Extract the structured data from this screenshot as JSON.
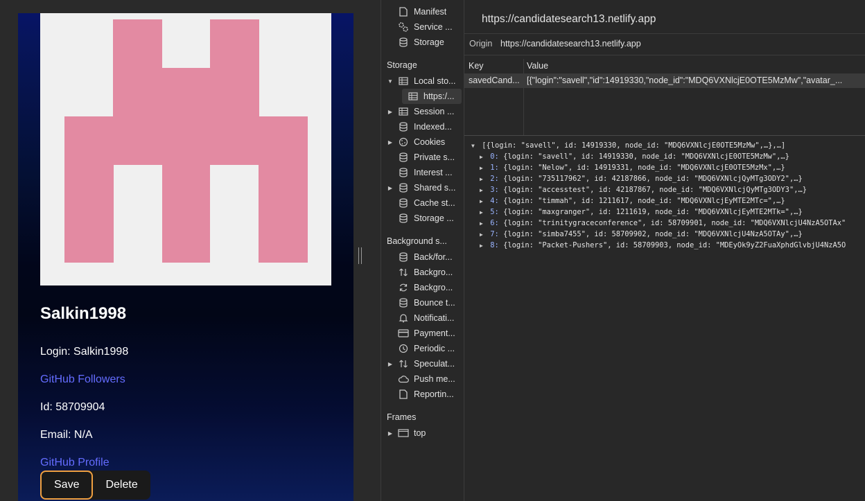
{
  "candidate": {
    "name": "Salkin1998",
    "login_line": "Login: Salkin1998",
    "followers_link": "GitHub Followers",
    "id_line": "Id: 58709904",
    "email_line": "Email: N/A",
    "profile_link": "GitHub Profile",
    "save_label": "Save",
    "delete_label": "Delete"
  },
  "devtools": {
    "sidebar": {
      "app_items": [
        {
          "label": "Manifest",
          "icon": "document-icon"
        },
        {
          "label": "Service ...",
          "icon": "gears-icon"
        },
        {
          "label": "Storage",
          "icon": "database-icon"
        }
      ],
      "storage_header": "Storage",
      "storage_items": [
        {
          "label": "Local sto...",
          "icon": "table-icon"
        },
        {
          "label": "https:/...",
          "icon": "table-icon"
        },
        {
          "label": "Session ...",
          "icon": "table-icon"
        },
        {
          "label": "Indexed...",
          "icon": "database-icon"
        },
        {
          "label": "Cookies",
          "icon": "cookie-icon"
        },
        {
          "label": "Private s...",
          "icon": "database-icon"
        },
        {
          "label": "Interest ...",
          "icon": "database-icon"
        },
        {
          "label": "Shared s...",
          "icon": "database-icon"
        },
        {
          "label": "Cache st...",
          "icon": "database-icon"
        },
        {
          "label": "Storage ...",
          "icon": "database-icon"
        }
      ],
      "background_header": "Background s...",
      "background_items": [
        {
          "label": "Back/for...",
          "icon": "database-icon"
        },
        {
          "label": "Backgro...",
          "icon": "sync-arrows-icon"
        },
        {
          "label": "Backgro...",
          "icon": "refresh-icon"
        },
        {
          "label": "Bounce t...",
          "icon": "database-icon"
        },
        {
          "label": "Notificati...",
          "icon": "bell-icon"
        },
        {
          "label": "Payment...",
          "icon": "card-icon"
        },
        {
          "label": "Periodic ...",
          "icon": "clock-icon"
        },
        {
          "label": "Speculat...",
          "icon": "sync-arrows-icon"
        },
        {
          "label": "Push me...",
          "icon": "cloud-icon"
        },
        {
          "label": "Reportin...",
          "icon": "document-icon"
        }
      ],
      "frames_header": "Frames",
      "frames_items": [
        {
          "label": "top",
          "icon": "frame-icon"
        }
      ]
    },
    "header_url": "https://candidatesearch13.netlify.app",
    "origin_label": "Origin",
    "origin_value": "https://candidatesearch13.netlify.app",
    "table": {
      "key_header": "Key",
      "value_header": "Value",
      "row_key": "savedCand...",
      "row_value": "[{\"login\":\"savell\",\"id\":14919330,\"node_id\":\"MDQ6VXNlcjE0OTE5MzMw\",\"avatar_..."
    },
    "preview": {
      "root": "[{login: \"savell\", id: 14919330, node_id: \"MDQ6VXNlcjE0OTE5MzMw\",…},…]",
      "items": [
        {
          "idx": "0",
          "text": "{login: \"savell\", id: 14919330, node_id: \"MDQ6VXNlcjE0OTE5MzMw\",…}"
        },
        {
          "idx": "1",
          "text": "{login: \"Nelow\", id: 14919331, node_id: \"MDQ6VXNlcjE0OTE5MzMx\",…}"
        },
        {
          "idx": "2",
          "text": "{login: \"735117962\", id: 42187866, node_id: \"MDQ6VXNlcjQyMTg3ODY2\",…}"
        },
        {
          "idx": "3",
          "text": "{login: \"accesstest\", id: 42187867, node_id: \"MDQ6VXNlcjQyMTg3ODY3\",…}"
        },
        {
          "idx": "4",
          "text": "{login: \"timmah\", id: 1211617, node_id: \"MDQ6VXNlcjEyMTE2MTc=\",…}"
        },
        {
          "idx": "5",
          "text": "{login: \"maxgranger\", id: 1211619, node_id: \"MDQ6VXNlcjEyMTE2MTk=\",…}"
        },
        {
          "idx": "6",
          "text": "{login: \"trinitygraceconference\", id: 58709901, node_id: \"MDQ6VXNlcjU4NzA5OTAx\""
        },
        {
          "idx": "7",
          "text": "{login: \"simba7455\", id: 58709902, node_id: \"MDQ6VXNlcjU4NzA5OTAy\",…}"
        },
        {
          "idx": "8",
          "text": "{login: \"Packet-Pushers\", id: 58709903, node_id: \"MDEyOk9yZ2FuaXphdGlvbjU4NzA5O"
        }
      ]
    }
  },
  "colors": {
    "link": "#646cff",
    "avatar_pink": "#e38aa2",
    "save_border": "#f0a040"
  }
}
